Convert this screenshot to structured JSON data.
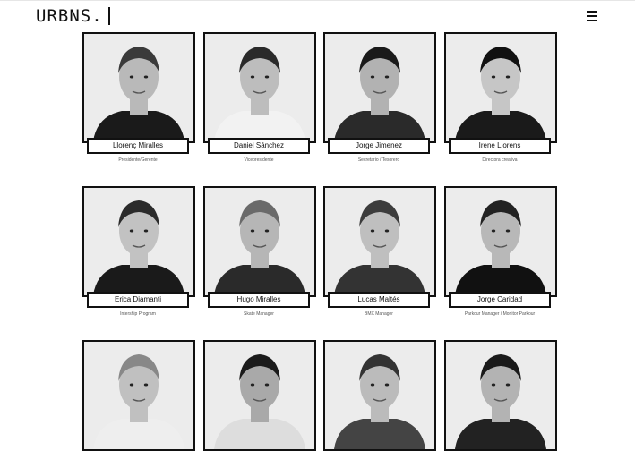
{
  "header": {
    "logo": "URBNS.",
    "menu_icon": "hamburger-menu-icon"
  },
  "team": {
    "members": [
      {
        "name": "Llorenç Miralles",
        "role": "Presidente/Gerente"
      },
      {
        "name": "Daniel Sánchez",
        "role": "Vicepresidente"
      },
      {
        "name": "Jorge Jimenez",
        "role": "Secretario / Tesorero"
      },
      {
        "name": "Irene Llorens",
        "role": "Directora creativa"
      },
      {
        "name": "Erica Diamanti",
        "role": "Intership Program"
      },
      {
        "name": "Hugo Miralles",
        "role": "Skate Manager"
      },
      {
        "name": "Lucas Maltés",
        "role": "BMX Manager"
      },
      {
        "name": "Jorge Caridad",
        "role": "Parkour Manager / Monitor Parkour"
      },
      {
        "name": "",
        "role": ""
      },
      {
        "name": "",
        "role": ""
      },
      {
        "name": "",
        "role": ""
      },
      {
        "name": "",
        "role": ""
      }
    ]
  }
}
